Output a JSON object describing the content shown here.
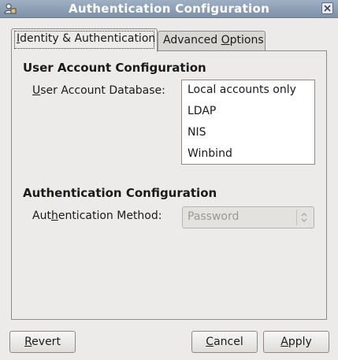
{
  "window": {
    "title": "Authentication Configuration"
  },
  "tabs": [
    {
      "label_pre": "",
      "mnemonic": "I",
      "label_post": "dentity & Authentication",
      "active": true
    },
    {
      "label_pre": "Advanced ",
      "mnemonic": "O",
      "label_post": "ptions",
      "active": false
    }
  ],
  "user_account": {
    "heading": "User Account Configuration",
    "db_label_pre": "",
    "db_label_mnemonic": "U",
    "db_label_post": "ser Account Database:",
    "db_options": [
      "Local accounts only",
      "LDAP",
      "NIS",
      "Winbind"
    ]
  },
  "authentication": {
    "heading": "Authentication Configuration",
    "method_label_pre": "Aut",
    "method_label_mnemonic": "h",
    "method_label_post": "entication Method:",
    "method_value": "Password",
    "method_enabled": false
  },
  "buttons": {
    "revert_mnemonic": "R",
    "revert_rest": "evert",
    "cancel_mnemonic": "C",
    "cancel_rest": "ancel",
    "apply_mnemonic": "A",
    "apply_rest": "pply"
  },
  "icons": {
    "app": "authentication-app-icon",
    "close": "close-icon",
    "combo_arrows": "up-down-arrows-icon"
  }
}
